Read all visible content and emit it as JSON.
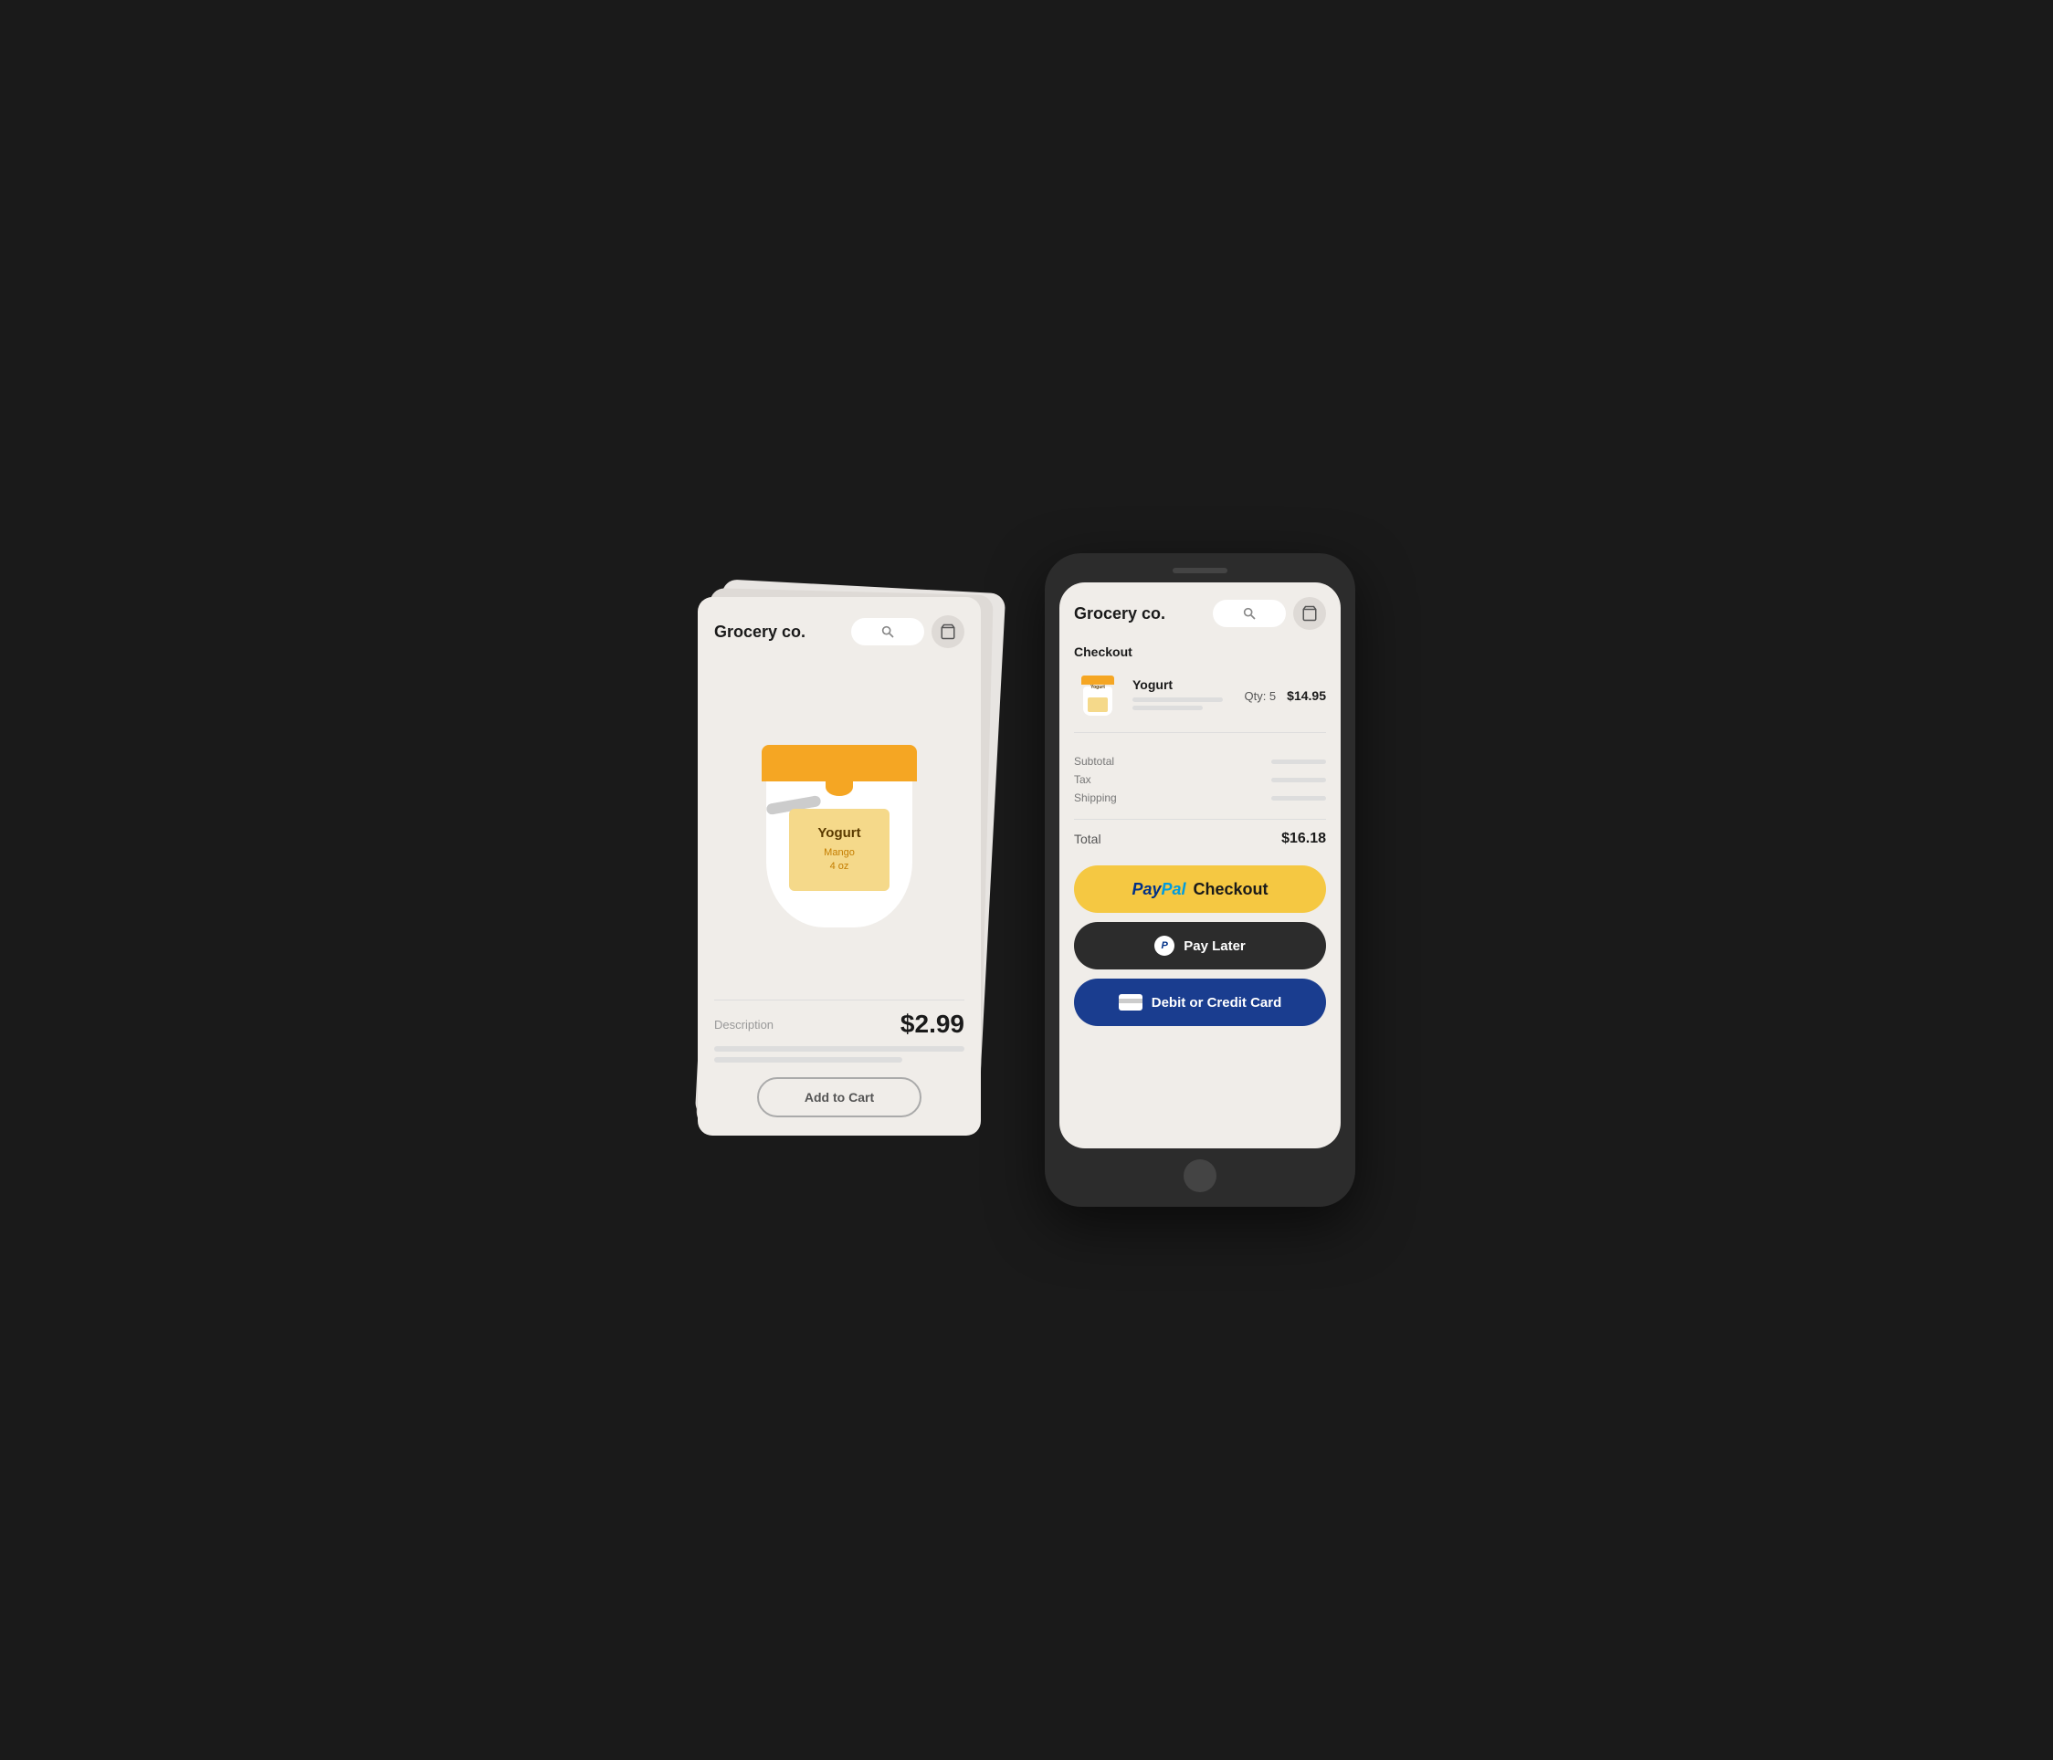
{
  "scene": {
    "background": "#1a1a1a"
  },
  "left_phone": {
    "logo": "Grocery co.",
    "search_placeholder": "",
    "product": {
      "name": "Yogurt",
      "flavor": "Mango",
      "size": "4 oz",
      "description_label": "Description",
      "price": "$2.99"
    },
    "add_to_cart_label": "Add to Cart"
  },
  "right_phone": {
    "logo": "Grocery co.",
    "checkout_label": "Checkout",
    "order": {
      "item_name": "Yogurt",
      "item_qty_label": "Qty: 5",
      "item_price": "$14.95"
    },
    "totals": {
      "subtotal_label": "Subtotal",
      "tax_label": "Tax",
      "shipping_label": "Shipping",
      "total_label": "Total",
      "total_amount": "$16.18"
    },
    "buttons": {
      "paypal_checkout": "Checkout",
      "pay_later": "Pay Later",
      "credit_card": "Debit or Credit Card"
    }
  }
}
